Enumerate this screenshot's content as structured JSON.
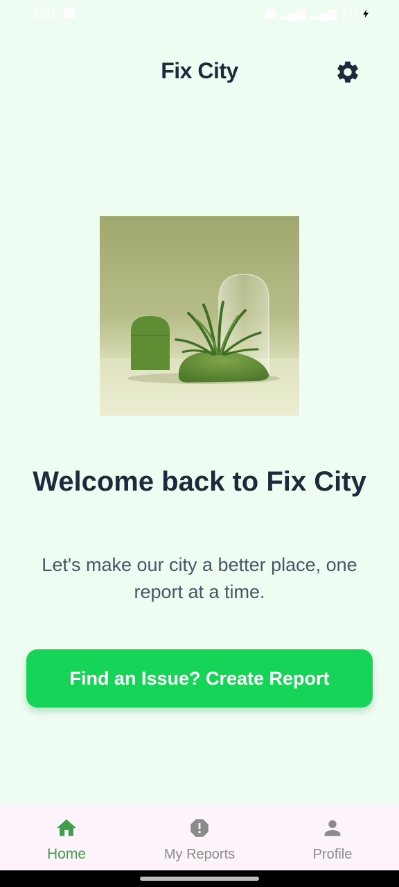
{
  "status_bar": {
    "time": "3:51",
    "right_text": "71%"
  },
  "app_bar": {
    "title": "Fix City",
    "settings_icon": "gear-icon"
  },
  "hero": {
    "image_icon": "plant-illustration"
  },
  "welcome": {
    "title": "Welcome back to Fix City",
    "subtitle": "Let's make our city a better place, one report at a time."
  },
  "cta": {
    "label": "Find an Issue? Create Report",
    "color": "#16d457"
  },
  "bottom_nav": {
    "items": [
      {
        "label": "Home",
        "icon": "home-icon",
        "active": true
      },
      {
        "label": "My Reports",
        "icon": "report-alert-icon",
        "active": false
      },
      {
        "label": "Profile",
        "icon": "person-icon",
        "active": false
      }
    ],
    "active_color": "#3f9e4e",
    "inactive_color": "#8b8b8b"
  }
}
